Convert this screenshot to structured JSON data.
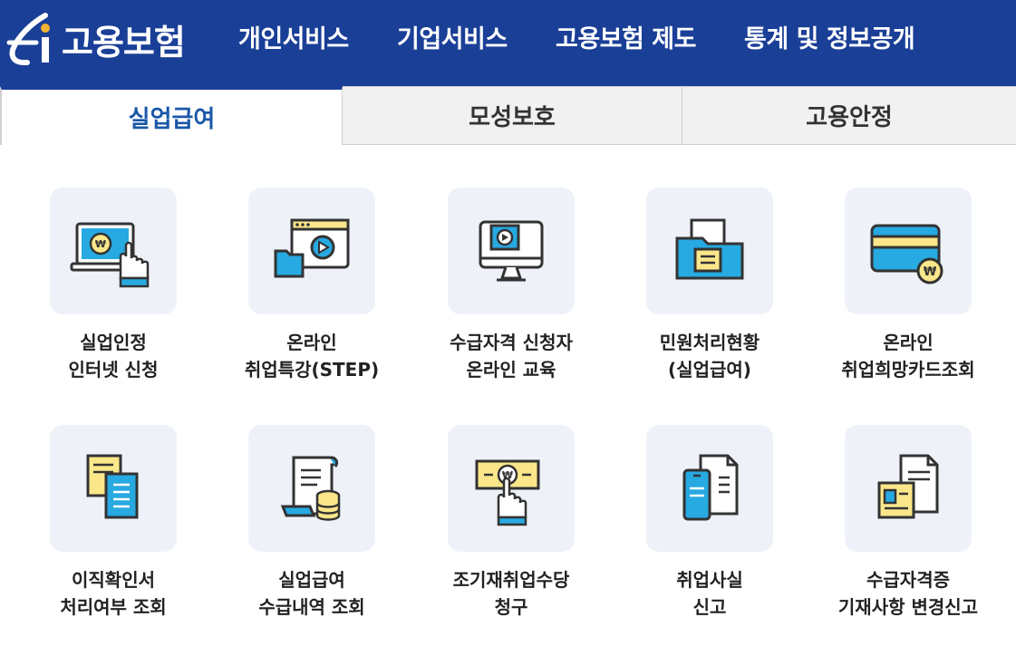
{
  "header": {
    "logo_text": "고용보험",
    "nav": [
      {
        "label": "개인서비스"
      },
      {
        "label": "기업서비스"
      },
      {
        "label": "고용보험 제도"
      },
      {
        "label": "통계 및 정보공개"
      }
    ]
  },
  "tabs": [
    {
      "label": "실업급여",
      "active": true
    },
    {
      "label": "모성보호",
      "active": false
    },
    {
      "label": "고용안정",
      "active": false
    }
  ],
  "services": [
    {
      "line1": "실업인정",
      "line2": "인터넷 신청",
      "icon": "laptop-touch-icon"
    },
    {
      "line1": "온라인",
      "line2": "취업특강(STEP)",
      "icon": "online-video-icon"
    },
    {
      "line1": "수급자격 신청자",
      "line2": "온라인 교육",
      "icon": "monitor-play-icon"
    },
    {
      "line1": "민원처리현황",
      "line2": "(실업급여)",
      "icon": "folder-document-icon"
    },
    {
      "line1": "온라인",
      "line2": "취업희망카드조회",
      "icon": "card-icon"
    },
    {
      "line1": "이직확인서",
      "line2": "처리여부 조회",
      "icon": "documents-icon"
    },
    {
      "line1": "실업급여",
      "line2": "수급내역 조회",
      "icon": "scroll-coins-icon"
    },
    {
      "line1": "조기재취업수당",
      "line2": "청구",
      "icon": "hand-money-icon"
    },
    {
      "line1": "취업사실",
      "line2": "신고",
      "icon": "phone-document-icon"
    },
    {
      "line1": "수급자격증",
      "line2": "기재사항 변경신고",
      "icon": "id-document-icon"
    }
  ],
  "colors": {
    "brand": "#1a3f97",
    "active_tab_text": "#1a57a8",
    "icon_blue": "#27a9e1",
    "icon_yellow": "#fbe78a"
  }
}
